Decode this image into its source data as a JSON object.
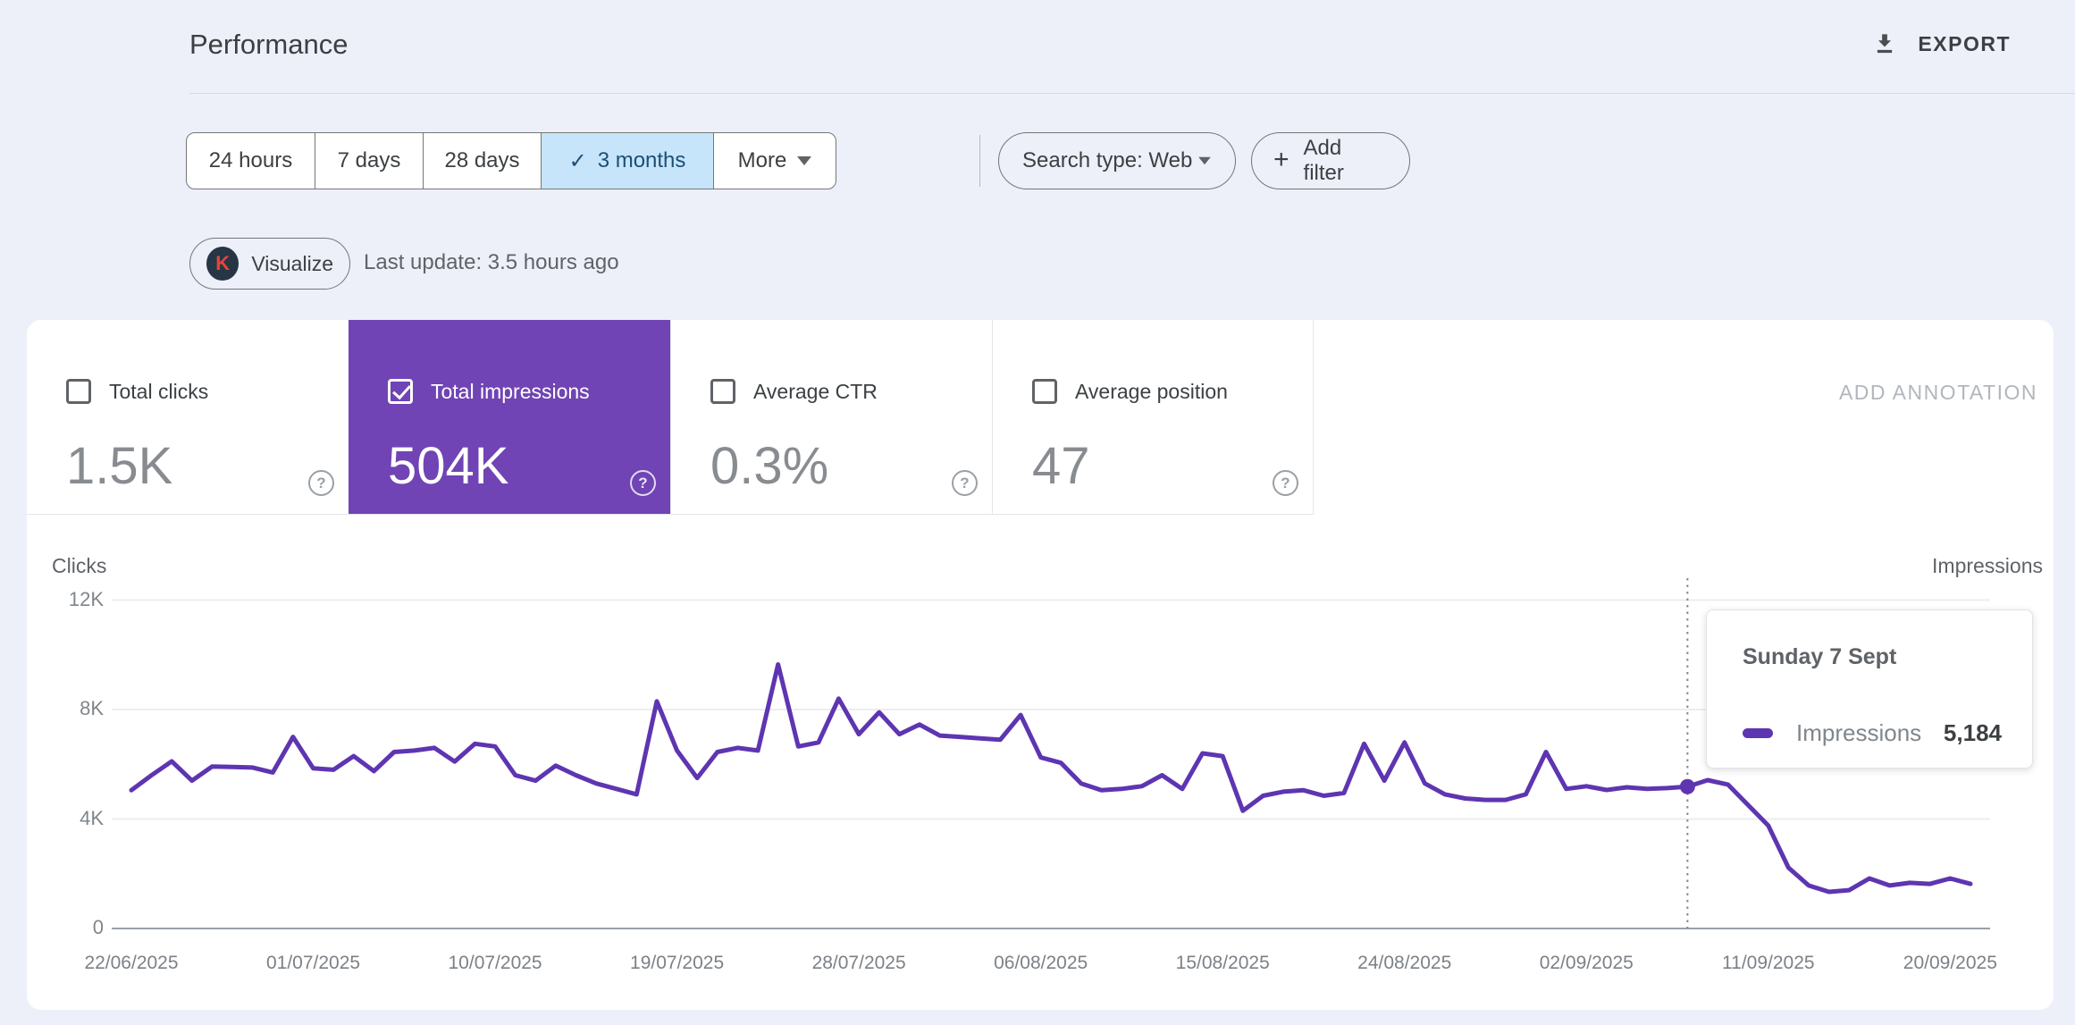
{
  "header": {
    "title": "Performance",
    "export_label": "EXPORT"
  },
  "filters": {
    "ranges": [
      {
        "label": "24 hours",
        "selected": false
      },
      {
        "label": "7 days",
        "selected": false
      },
      {
        "label": "28 days",
        "selected": false
      },
      {
        "label": "3 months",
        "selected": true
      }
    ],
    "check_glyph": "✓",
    "more_label": "More",
    "search_type_label": "Search type: Web",
    "add_filter_label": "Add filter",
    "plus_glyph": "+"
  },
  "visualize": {
    "logo_letter": "K",
    "label": "Visualize",
    "last_update": "Last update: 3.5 hours ago"
  },
  "metrics": {
    "cards": [
      {
        "label": "Total clicks",
        "value": "1.5K",
        "checked": false
      },
      {
        "label": "Total impressions",
        "value": "504K",
        "checked": true
      },
      {
        "label": "Average CTR",
        "value": "0.3%",
        "checked": false
      },
      {
        "label": "Average position",
        "value": "47",
        "checked": false
      }
    ],
    "help_glyph": "?",
    "add_annotation_label": "ADD ANNOTATION",
    "selected_card_color": "#7044b4"
  },
  "tooltip": {
    "title": "Sunday 7 Sept",
    "series": "Impressions",
    "value": "5,184"
  },
  "chart_data": {
    "type": "line",
    "ylabel_left": "Clicks",
    "ylabel_right": "Impressions",
    "x_start_date": "22/06/2025",
    "x_tick_labels": [
      "22/06/2025",
      "01/07/2025",
      "10/07/2025",
      "19/07/2025",
      "28/07/2025",
      "06/08/2025",
      "15/08/2025",
      "24/08/2025",
      "02/09/2025",
      "11/09/2025",
      "20/09/2025"
    ],
    "x_tick_day_indices": [
      0,
      9,
      18,
      27,
      36,
      45,
      54,
      63,
      72,
      81,
      90
    ],
    "yticks": [
      {
        "label": "12K",
        "value": 12000
      },
      {
        "label": "8K",
        "value": 8000
      },
      {
        "label": "4K",
        "value": 4000
      },
      {
        "label": "0",
        "value": 0
      }
    ],
    "ylim": [
      0,
      12800
    ],
    "grid": true,
    "series": [
      {
        "name": "Impressions",
        "color": "#5e35b1",
        "values": [
          5050,
          5600,
          6110,
          5400,
          5920,
          5900,
          5880,
          5700,
          7000,
          5850,
          5800,
          6300,
          5750,
          6450,
          6500,
          6600,
          6100,
          6750,
          6650,
          5600,
          5400,
          5950,
          5600,
          5300,
          5100,
          4900,
          8300,
          6500,
          5500,
          6450,
          6600,
          6500,
          9650,
          6650,
          6800,
          8400,
          7100,
          7900,
          7100,
          7450,
          7050,
          7000,
          6950,
          6900,
          7800,
          6250,
          6050,
          5300,
          5050,
          5100,
          5200,
          5600,
          5100,
          6400,
          6300,
          4300,
          4850,
          5000,
          5050,
          4850,
          4950,
          6750,
          5400,
          6800,
          5300,
          4900,
          4750,
          4700,
          4700,
          4900,
          6450,
          5100,
          5200,
          5060,
          5160,
          5100,
          5130,
          5184,
          5420,
          5260,
          4510,
          3760,
          2220,
          1570,
          1340,
          1400,
          1830,
          1570,
          1670,
          1630,
          1830,
          1630
        ]
      }
    ],
    "highlight": {
      "day_index": 77,
      "date_label": "Sunday 7 Sept",
      "value": 5184
    }
  }
}
